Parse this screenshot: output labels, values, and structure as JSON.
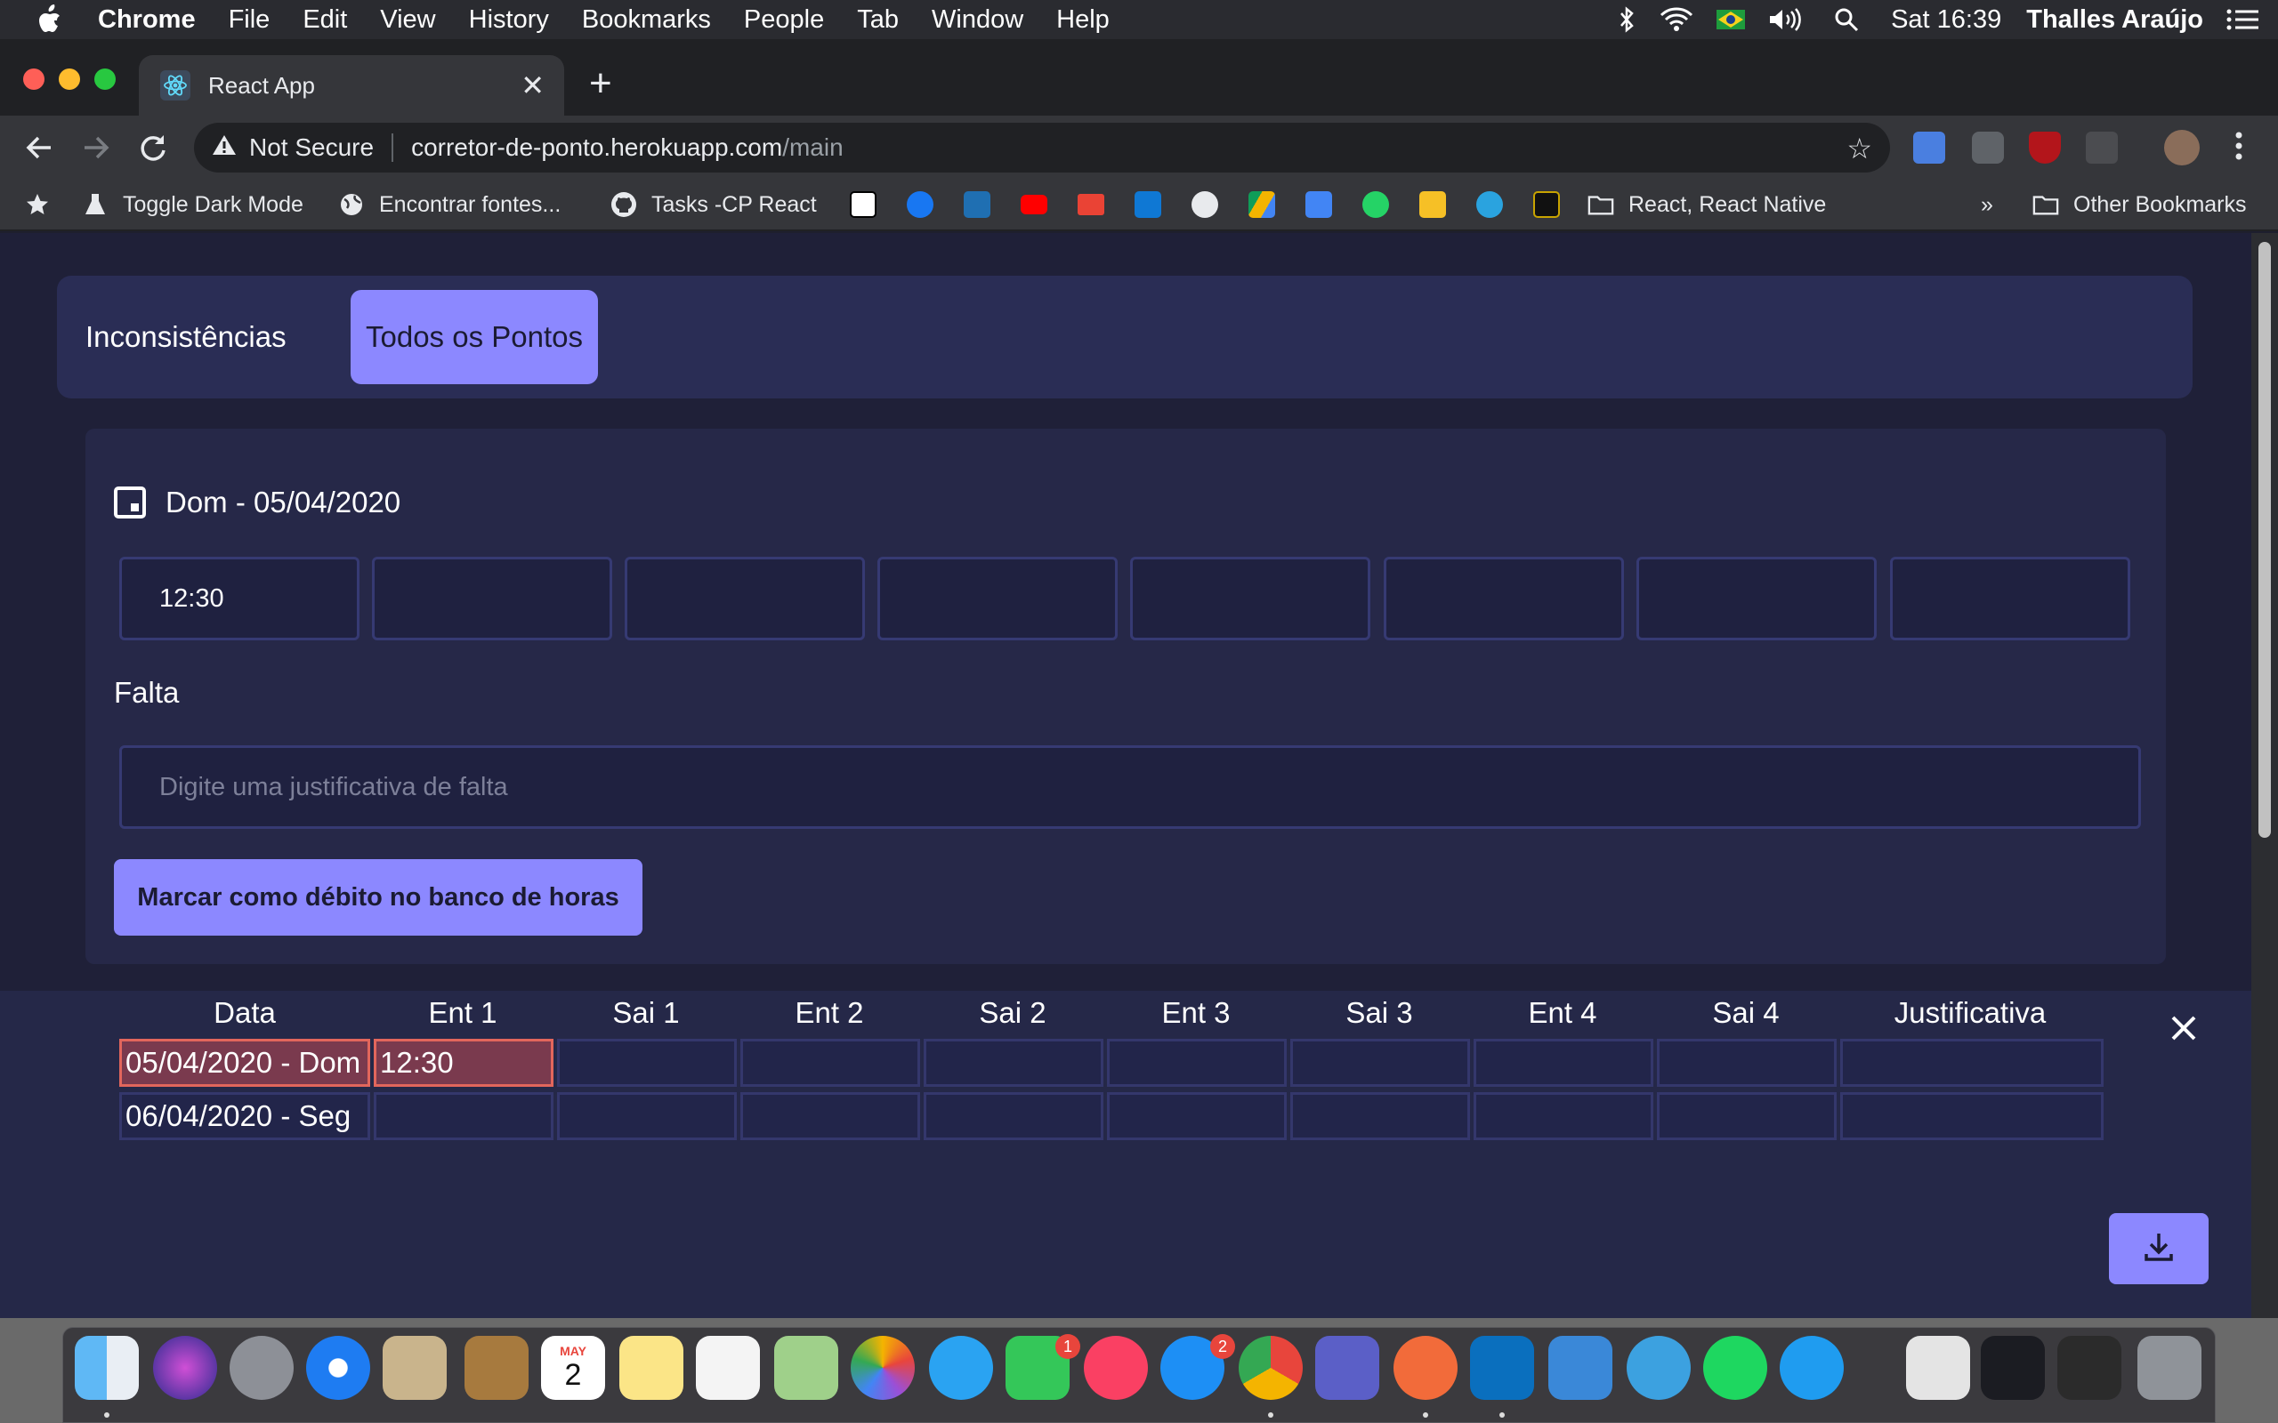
{
  "menubar": {
    "app": "Chrome",
    "items": [
      "File",
      "Edit",
      "View",
      "History",
      "Bookmarks",
      "People",
      "Tab",
      "Window",
      "Help"
    ],
    "clock": "Sat 16:39",
    "user": "Thalles Araújo"
  },
  "browser": {
    "tab_title": "React App",
    "security": "Not Secure",
    "url_host": "corretor-de-ponto.herokuapp.com",
    "url_path": "/main",
    "bookmarks": [
      "Toggle Dark Mode",
      "Encontrar fontes...",
      "Tasks -CP React",
      "React, React Native"
    ],
    "overflow": "»",
    "other_bookmarks": "Other Bookmarks"
  },
  "app": {
    "tabs": [
      "Inconsistências",
      "Todos os Pontos"
    ],
    "active_tab": "Todos os Pontos",
    "date_label": "Dom - 05/04/2020",
    "time_entries": [
      "12:30",
      "",
      "",
      "",
      "",
      "",
      "",
      ""
    ],
    "falta_label": "Falta",
    "justification_placeholder": "Digite uma justificativa de falta",
    "debit_button": "Marcar como débito no banco de horas"
  },
  "table": {
    "headers": [
      "Data",
      "Ent 1",
      "Sai 1",
      "Ent 2",
      "Sai 2",
      "Ent 3",
      "Sai 3",
      "Ent 4",
      "Sai 4",
      "Justificativa"
    ],
    "rows": [
      [
        "05/04/2020 - Dom",
        "12:30",
        "",
        "",
        "",
        "",
        "",
        "",
        "",
        ""
      ],
      [
        "06/04/2020 - Seg",
        "",
        "",
        "",
        "",
        "",
        "",
        "",
        "",
        ""
      ]
    ]
  },
  "dock": {
    "badges": {
      "facetime": "1",
      "appstore": "2"
    },
    "calendar_month": "MAY",
    "calendar_day": "2"
  },
  "colors": {
    "accent": "#8c88ff",
    "page_bg": "#1f2038",
    "card_bg": "#262848",
    "highlight": "#e2665c"
  }
}
